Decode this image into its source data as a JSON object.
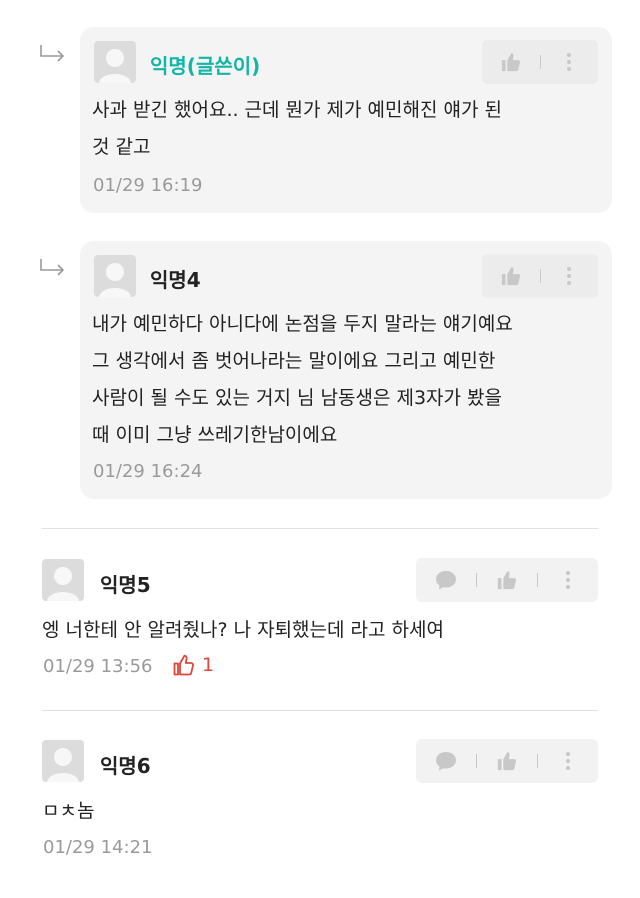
{
  "replies": [
    {
      "author": "익명(글쓴이)",
      "is_author": true,
      "text": "사과 받긴 했어요.. 근데 뭔가 제가 예민해진 얘가 된\n것 같고",
      "time": "01/29 16:19"
    },
    {
      "author": "익명4",
      "is_author": false,
      "text": "내가 예민하다 아니다에 논점을 두지 말라는 얘기예요\n그 생각에서 좀 벗어나라는 말이에요 그리고 예민한\n사람이 될 수도 있는 거지 님 남동생은 제3자가 봤을\n때 이미 그냥 쓰레기한남이에요",
      "time": "01/29 16:24"
    }
  ],
  "comments": [
    {
      "author": "익명5",
      "text": "엥 너한테 안 알려줬나? 나 자퇴했는데 라고 하세여",
      "time": "01/29 13:56",
      "likes": "1"
    },
    {
      "author": "익명6",
      "text": "ㅁㅊ놈",
      "time": "01/29 14:21"
    }
  ],
  "icons": {
    "reply_arrow": "reply-arrow-icon",
    "avatar": "anonymous-avatar",
    "like": "thumbs-up-icon",
    "more": "more-vertical-icon",
    "comment": "speech-bubble-icon"
  },
  "colors": {
    "author_name": "#13b6a6",
    "like_count": "#e0443b",
    "timestamp": "#9a9a9a",
    "reply_background": "#f4f4f4"
  }
}
